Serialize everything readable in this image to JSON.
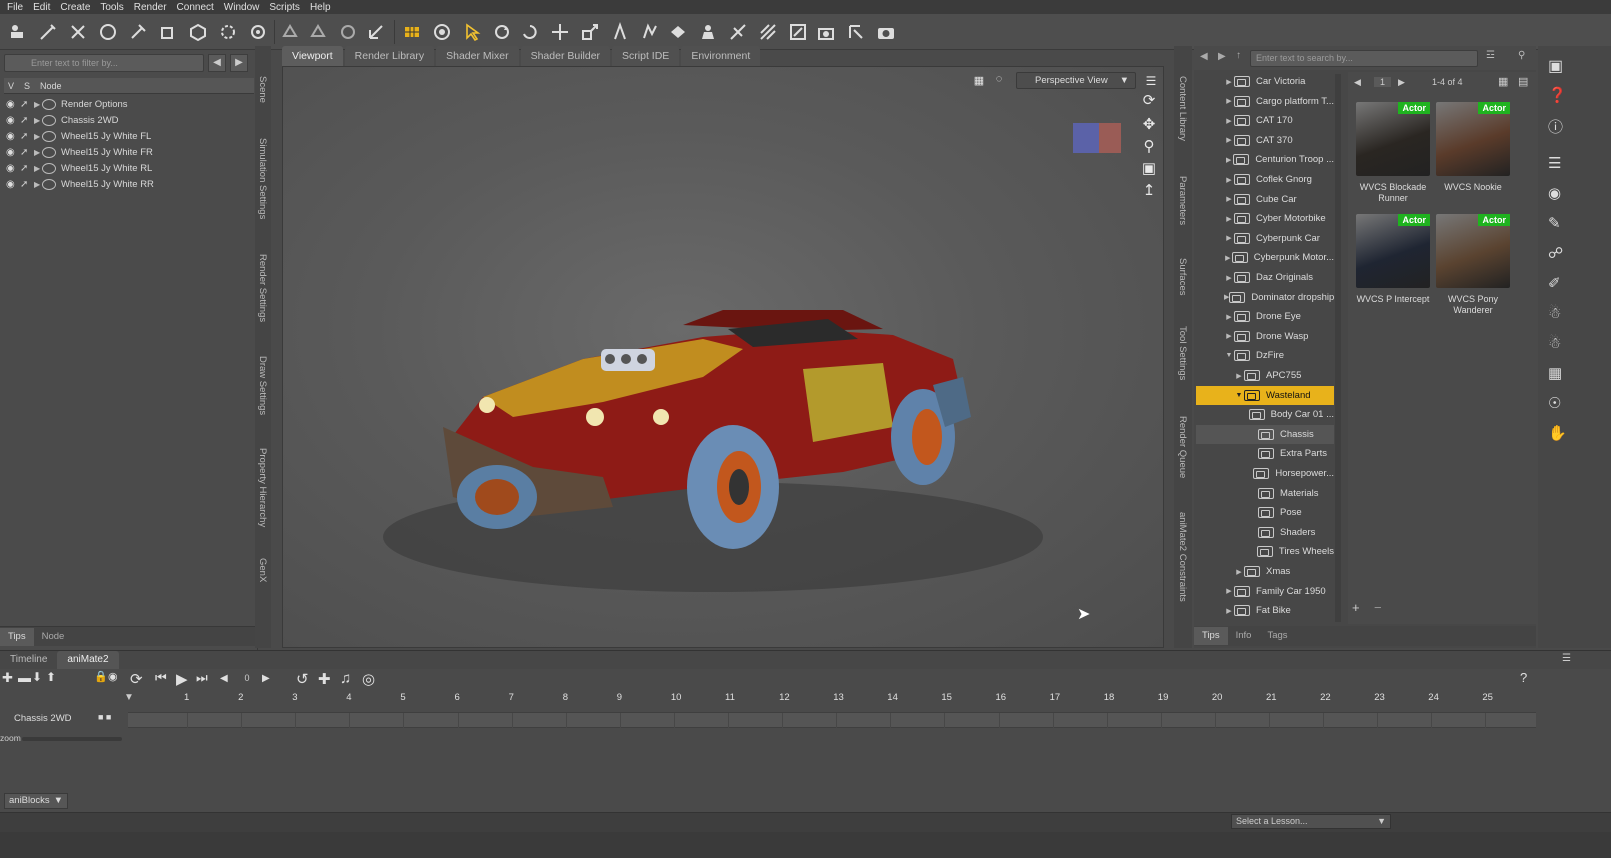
{
  "menu": [
    "File",
    "Edit",
    "Create",
    "Tools",
    "Render",
    "Connect",
    "Window",
    "Scripts",
    "Help"
  ],
  "scene": {
    "filter_placeholder": "Enter text to filter by...",
    "col_v": "V",
    "col_s": "S",
    "col_node": "Node",
    "rows": [
      "Render Options",
      "Chassis 2WD",
      "Wheel15 Jy White FL",
      "Wheel15 Jy White FR",
      "Wheel15 Jy White RL",
      "Wheel15 Jy White RR"
    ],
    "tabs": [
      "Tips",
      "Node"
    ]
  },
  "side_tabs_left": [
    "Scene",
    "Simulation Settings",
    "Render Settings",
    "Draw Settings",
    "Property Hierarchy",
    "GenX"
  ],
  "center_tabs": [
    "Viewport",
    "Render Library",
    "Shader Mixer",
    "Shader Builder",
    "Script IDE",
    "Environment"
  ],
  "viewport": {
    "camera": "Perspective View"
  },
  "side_tabs_right": [
    "Content Library",
    "Parameters",
    "Surfaces",
    "Tool Settings",
    "Render Queue",
    "aniMate2 Constraints"
  ],
  "library": {
    "search_placeholder": "Enter text to search by...",
    "tree": [
      {
        "label": "Car Victoria",
        "level": 0,
        "state": "closed"
      },
      {
        "label": "Cargo platform T...",
        "level": 0,
        "state": "closed"
      },
      {
        "label": "CAT 170",
        "level": 0,
        "state": "closed"
      },
      {
        "label": "CAT 370",
        "level": 0,
        "state": "closed"
      },
      {
        "label": "Centurion Troop ...",
        "level": 0,
        "state": "closed"
      },
      {
        "label": "Coflek Gnorg",
        "level": 0,
        "state": "closed"
      },
      {
        "label": "Cube Car",
        "level": 0,
        "state": "closed"
      },
      {
        "label": "Cyber Motorbike",
        "level": 0,
        "state": "closed"
      },
      {
        "label": "Cyberpunk Car",
        "level": 0,
        "state": "closed"
      },
      {
        "label": "Cyberpunk Motor...",
        "level": 0,
        "state": "closed"
      },
      {
        "label": "Daz Originals",
        "level": 0,
        "state": "closed"
      },
      {
        "label": "Dominator dropship",
        "level": 0,
        "state": "closed"
      },
      {
        "label": "Drone Eye",
        "level": 0,
        "state": "closed"
      },
      {
        "label": "Drone Wasp",
        "level": 0,
        "state": "closed"
      },
      {
        "label": "DzFire",
        "level": 0,
        "state": "open"
      },
      {
        "label": "APC755",
        "level": 1,
        "state": "closed"
      },
      {
        "label": "Wasteland",
        "level": 1,
        "state": "open"
      },
      {
        "label": "Body Car 01 ...",
        "level": 2,
        "state": "leaf"
      },
      {
        "label": "Chassis",
        "level": 2,
        "state": "leaf"
      },
      {
        "label": "Extra Parts",
        "level": 2,
        "state": "leaf"
      },
      {
        "label": "Horsepower...",
        "level": 2,
        "state": "leaf"
      },
      {
        "label": "Materials",
        "level": 2,
        "state": "leaf"
      },
      {
        "label": "Pose",
        "level": 2,
        "state": "leaf"
      },
      {
        "label": "Shaders",
        "level": 2,
        "state": "leaf"
      },
      {
        "label": "Tires Wheels",
        "level": 2,
        "state": "leaf"
      },
      {
        "label": "Xmas",
        "level": 1,
        "state": "closed"
      },
      {
        "label": "Family Car 1950",
        "level": 0,
        "state": "closed"
      },
      {
        "label": "Fat Bike",
        "level": 0,
        "state": "closed"
      }
    ],
    "page": "1",
    "count": "1-4 of 4",
    "items": [
      {
        "badge": "Actor",
        "name": "WVCS Blockade Runner",
        "color": "#2a2622"
      },
      {
        "badge": "Actor",
        "name": "WVCS Nookie",
        "color": "#5a3b2a"
      },
      {
        "badge": "Actor",
        "name": "WVCS P Intercept",
        "color": "#1f2532"
      },
      {
        "badge": "Actor",
        "name": "WVCS Pony Wanderer",
        "color": "#5a4330"
      }
    ],
    "bottom_tabs": [
      "Tips",
      "Info",
      "Tags"
    ]
  },
  "timeline": {
    "tabs": [
      "Timeline",
      "aniMate2"
    ],
    "frame": "0",
    "ticks": [
      "1",
      "2",
      "3",
      "4",
      "5",
      "6",
      "7",
      "8",
      "9",
      "10",
      "11",
      "12",
      "13",
      "14",
      "15",
      "16",
      "17",
      "18",
      "19",
      "20",
      "21",
      "22",
      "23",
      "24",
      "25"
    ],
    "track_label": "Chassis 2WD",
    "zoom_label": "zoom",
    "aniblocks": "aniBlocks"
  },
  "status": {
    "lesson": "Select a Lesson..."
  },
  "colors": {
    "selected": "#e8b21b",
    "actor_badge": "#1fb31f"
  }
}
